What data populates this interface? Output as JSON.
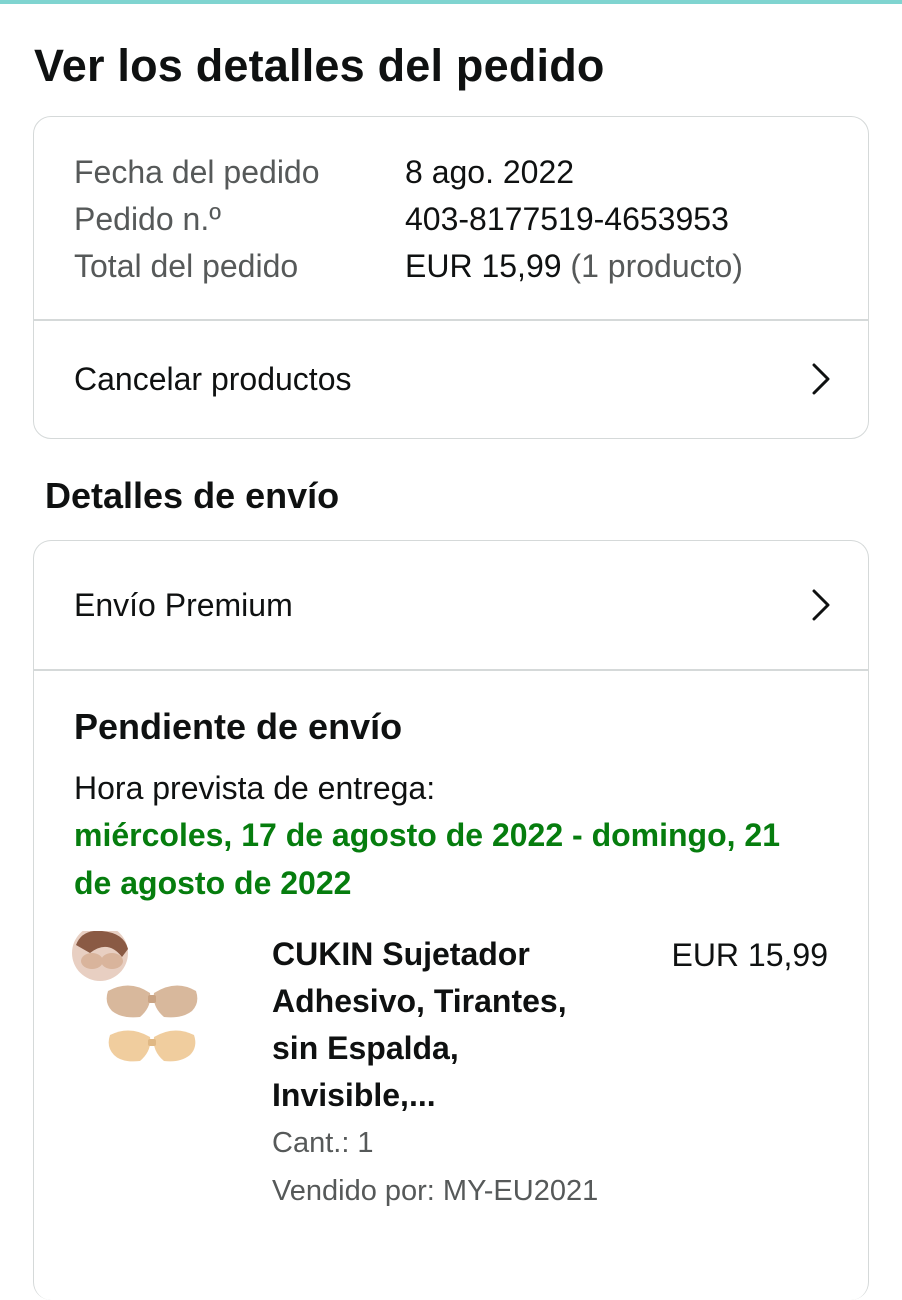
{
  "page": {
    "title": "Ver los detalles del pedido"
  },
  "order_summary": {
    "rows": [
      {
        "label": "Fecha del pedido",
        "value": "8 ago. 2022",
        "suffix": ""
      },
      {
        "label": "Pedido n.º",
        "value": "403-8177519-4653953",
        "suffix": ""
      },
      {
        "label": "Total del pedido",
        "value": "EUR 15,99",
        "suffix": " (1 producto)"
      }
    ],
    "cancel_label": "Cancelar productos"
  },
  "shipping": {
    "section_title": "Detalles de envío",
    "method_label": "Envío Premium",
    "status": "Pendiente de envío",
    "delivery_label": "Hora prevista de entrega:",
    "delivery_dates": "miércoles, 17 de agosto de 2022 - domingo, 21 de agosto de 2022"
  },
  "product": {
    "title": "CUKIN Sujetador Adhesivo, Tirantes, sin Espalda, Invisible,...",
    "price": "EUR 15,99",
    "quantity": "Cant.: 1",
    "seller": "Vendido por: MY-EU2021",
    "image_icon": "product-thumbnail"
  },
  "colors": {
    "accent_bar": "#7fd4d0",
    "delivery_green": "#067d0e",
    "border": "#d5d9d9",
    "muted_text": "#565959"
  },
  "icons": {
    "chevron": "chevron-right-icon"
  }
}
